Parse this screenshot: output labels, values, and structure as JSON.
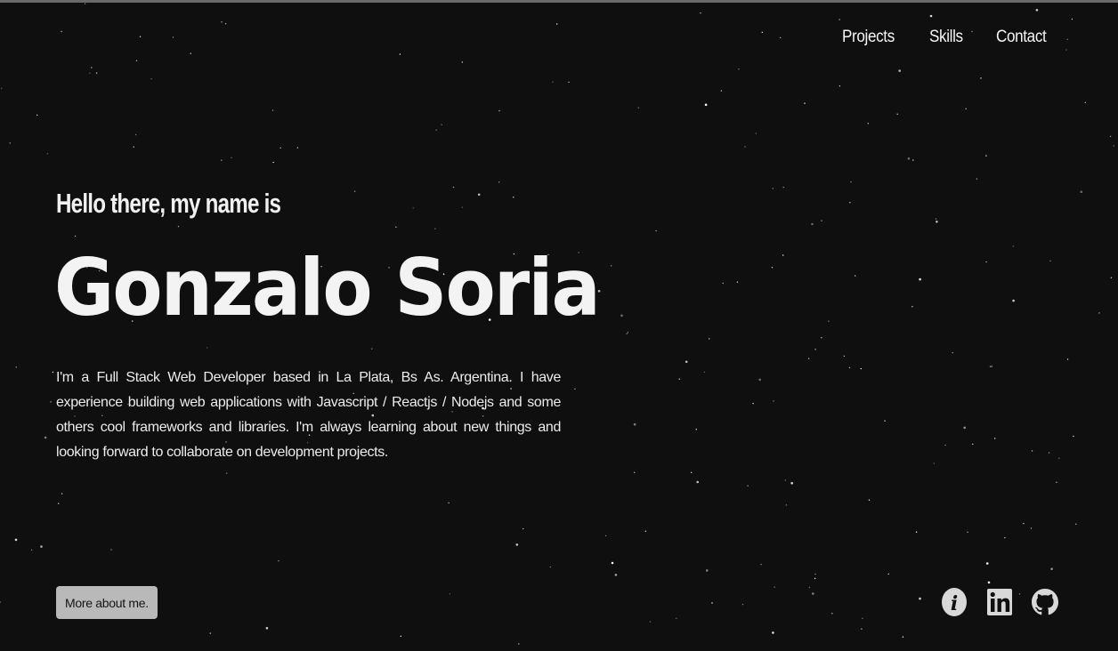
{
  "nav": {
    "items": [
      "Projects",
      "Skills",
      "Contact"
    ]
  },
  "hero": {
    "greeting": "Hello there, my name is",
    "name": "Gonzalo Soria",
    "bio": "I'm a Full Stack Web Developer based in La Plata, Bs As. Argentina. I have experience building web applications with Javascript / Reactjs / Nodejs and some others cool frameworks and libraries. I'm always learning about new things and looking forward to collaborate on development projects."
  },
  "more_button": {
    "label": "More about me."
  },
  "social": {
    "icons": [
      "info-icon",
      "linkedin-icon",
      "github-icon"
    ]
  },
  "colors": {
    "background": "#0f0f10",
    "text": "#f2f2f2",
    "button_bg": "#b9b9b9",
    "icon": "#d8d8d8"
  }
}
